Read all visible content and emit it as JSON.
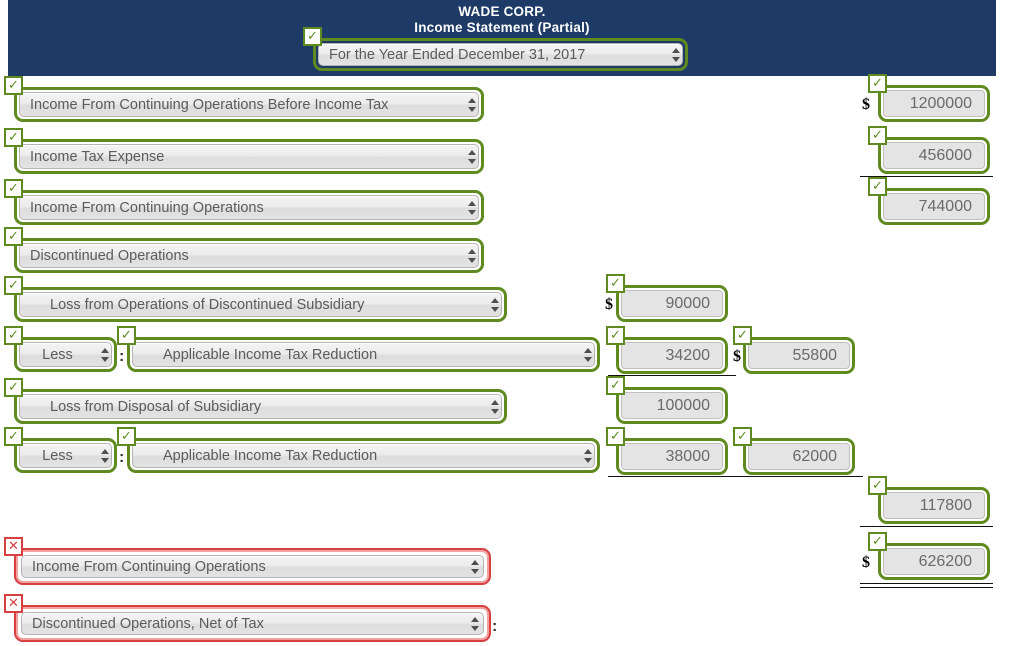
{
  "header": {
    "company": "WADE CORP.",
    "statement": "Income Statement (Partial)",
    "period_select": "For the Year Ended December 31, 2017",
    "band_color": "#1e3a66"
  },
  "status": {
    "correct_icon": "check-icon",
    "correct_glyph": "✓",
    "incorrect_icon": "x-icon",
    "incorrect_glyph": "✕",
    "correct_color": "#5f8a20",
    "incorrect_color": "#d64040"
  },
  "symbols": {
    "dollar": "$",
    "colon": ":"
  },
  "rows": [
    {
      "label": "Income From Continuing Operations Before Income Tax",
      "status": "correct",
      "amount_right": "1200000",
      "dollar_right": true
    },
    {
      "label": "Income Tax Expense",
      "status": "correct",
      "amount_right": "456000",
      "dollar_right": false
    },
    {
      "label": "Income From Continuing Operations",
      "status": "correct",
      "amount_right": "744000",
      "dollar_right": false
    },
    {
      "label": "Discontinued Operations",
      "status": "correct"
    },
    {
      "label": "Loss from Operations of Discontinued Subsidiary",
      "status": "correct",
      "amount_mid": "90000",
      "dollar_mid": true
    },
    {
      "prefix": "Less",
      "label": "Applicable Income Tax Reduction",
      "status": "correct",
      "amount_mid": "34200",
      "amount_mid2": "55800",
      "dollar_mid2": true
    },
    {
      "label": "Loss from Disposal of Subsidiary",
      "status": "correct",
      "amount_mid": "100000"
    },
    {
      "prefix": "Less",
      "label": "Applicable Income Tax Reduction",
      "status": "correct",
      "amount_mid": "38000",
      "amount_mid2": "62000"
    }
  ],
  "totals": {
    "subtotal": "117800",
    "net_income": "626200",
    "net_income_dollar": "$"
  },
  "bottom_rows": [
    {
      "label": "Income From Continuing Operations",
      "status": "incorrect"
    },
    {
      "label": "Discontinued Operations, Net of Tax",
      "status": "incorrect",
      "trailing_colon": ":"
    }
  ]
}
